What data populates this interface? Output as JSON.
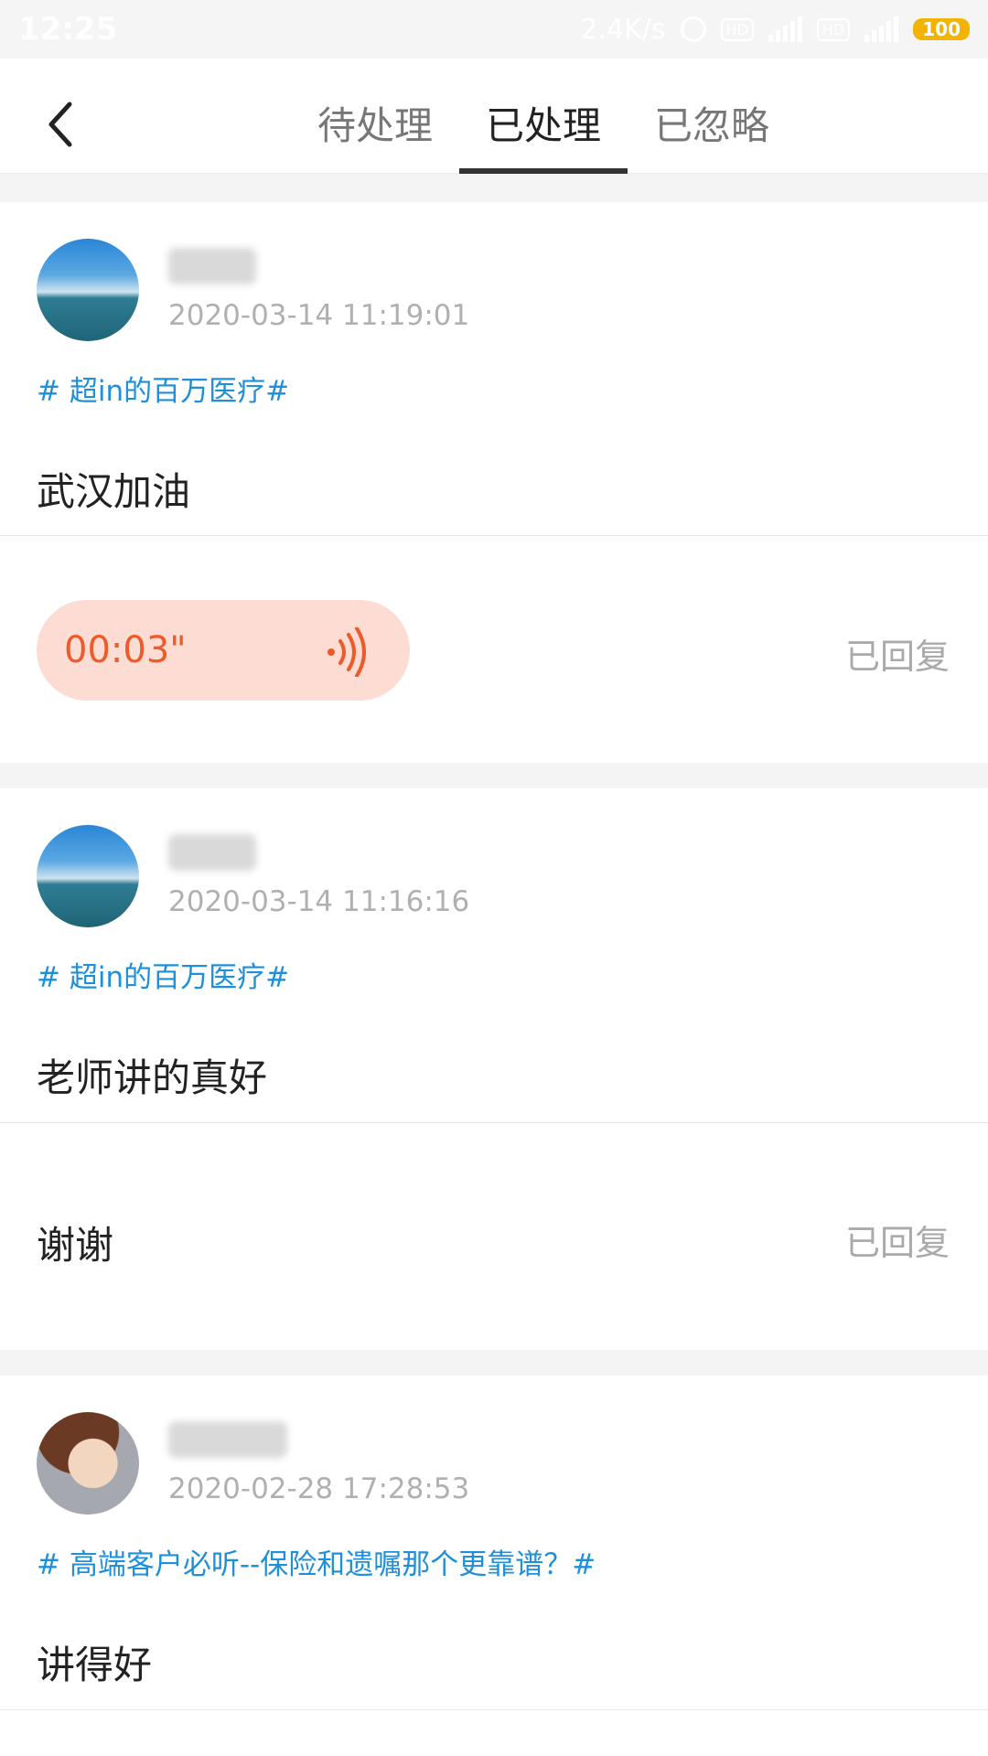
{
  "status_bar": {
    "time": "12:25",
    "network_speed": "2.4K/s",
    "battery": "100",
    "hd_label_1": "HD",
    "hd_label_2": "HD"
  },
  "tabs": [
    {
      "label": "待处理",
      "active": false
    },
    {
      "label": "已处理",
      "active": true
    },
    {
      "label": "已忽略",
      "active": false
    }
  ],
  "colors": {
    "accent_topic": "#1e8fd8",
    "voice_text": "#ee5a2a",
    "voice_bg": "#fcdcd3"
  },
  "items": [
    {
      "timestamp": "2020-03-14 11:19:01",
      "topic": "# 超in的百万医疗#",
      "comment": "武汉加油",
      "reply_type": "voice",
      "voice_duration": "00:03\"",
      "status": "已回复"
    },
    {
      "timestamp": "2020-03-14 11:16:16",
      "topic": "# 超in的百万医疗#",
      "comment": "老师讲的真好",
      "reply_type": "text",
      "reply": "谢谢",
      "status": "已回复"
    },
    {
      "timestamp": "2020-02-28 17:28:53",
      "topic": "# 高端客户必听--保险和遗嘱那个更靠谱？#",
      "comment": "讲得好"
    }
  ]
}
